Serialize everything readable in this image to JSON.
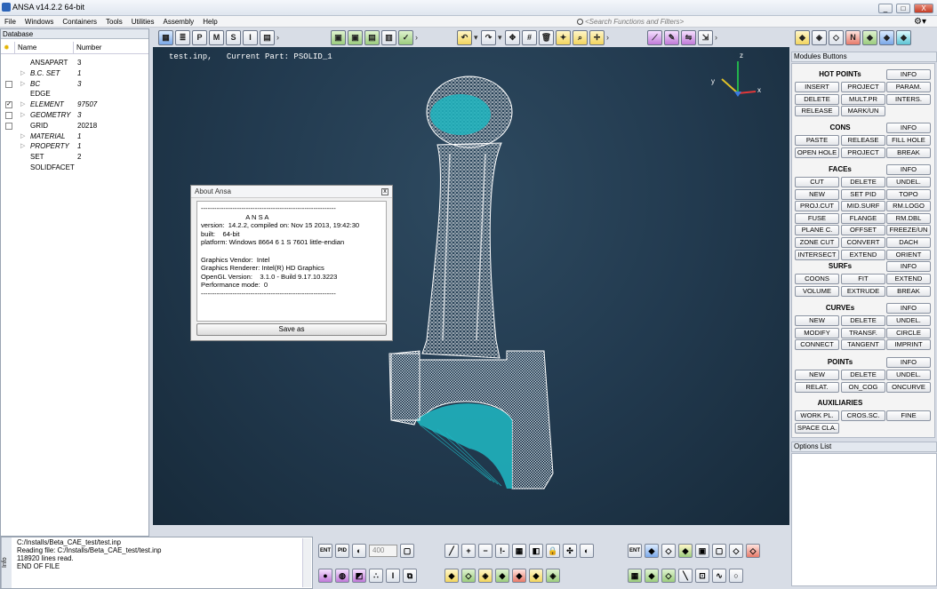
{
  "window": {
    "title": "ANSA v14.2.2 64-bit",
    "controls": [
      "_",
      "□",
      "X"
    ]
  },
  "menu": [
    "File",
    "Windows",
    "Containers",
    "Tools",
    "Utilities",
    "Assembly",
    "Help"
  ],
  "search": {
    "placeholder": "<Search Functions and Filters>"
  },
  "database": {
    "title": "Database",
    "columns": [
      "Name",
      "Number"
    ],
    "rows": [
      {
        "name": "ANSAPART",
        "number": "3",
        "italic": false,
        "checkbox": false,
        "expander": false
      },
      {
        "name": "B.C. SET",
        "number": "1",
        "italic": true,
        "checkbox": false,
        "expander": true
      },
      {
        "name": "BC",
        "number": "3",
        "italic": true,
        "checkbox": true,
        "expander": true,
        "checked": false
      },
      {
        "name": "EDGE",
        "number": "",
        "italic": false,
        "checkbox": false,
        "expander": false
      },
      {
        "name": "ELEMENT",
        "number": "97507",
        "italic": true,
        "checkbox": true,
        "expander": true,
        "checked": true
      },
      {
        "name": "GEOMETRY",
        "number": "3",
        "italic": true,
        "checkbox": true,
        "expander": true,
        "checked": false
      },
      {
        "name": "GRID",
        "number": "20218",
        "italic": false,
        "checkbox": true,
        "expander": false,
        "checked": false
      },
      {
        "name": "MATERIAL",
        "number": "1",
        "italic": true,
        "checkbox": false,
        "expander": true
      },
      {
        "name": "PROPERTY",
        "number": "1",
        "italic": true,
        "checkbox": false,
        "expander": true
      },
      {
        "name": "SET",
        "number": "2",
        "italic": false,
        "checkbox": false,
        "expander": false
      },
      {
        "name": "SOLIDFACET",
        "number": "",
        "italic": false,
        "checkbox": false,
        "expander": false
      }
    ]
  },
  "viewport": {
    "file": "test.inp,",
    "current_part": "Current Part: PSOLID_1",
    "axis": {
      "x": "x",
      "y": "y",
      "z": "z"
    }
  },
  "about": {
    "title": "About Ansa",
    "lines": [
      "------------------------------------------------------------",
      "                        A N S A",
      "version:  14.2.2, compiled on: Nov 15 2013, 19:42:30",
      "built:    64-bit",
      "platform: Windows 8664 6 1 S 7601 little-endian",
      "",
      "Graphics Vendor:  Intel",
      "Graphics Renderer: Intel(R) HD Graphics",
      "OpenGL Version:    3.1.0 - Build 9.17.10.3223",
      "Performance mode:  0",
      "------------------------------------------------------------"
    ],
    "save_label": "Save as"
  },
  "modules": {
    "title": "Modules Buttons",
    "sections": [
      {
        "title": "HOT POINTs",
        "info": "INFO",
        "buttons": [
          "INSERT",
          "PROJECT",
          "PARAM.",
          "DELETE",
          "MULT.PR",
          "INTERS.",
          "RELEASE",
          "MARK/UN"
        ]
      },
      {
        "title": "CONS",
        "info": "INFO",
        "buttons": [
          "PASTE",
          "RELEASE",
          "FILL HOLE",
          "OPEN HOLE",
          "PROJECT",
          "BREAK"
        ]
      },
      {
        "title": "FACEs",
        "info": "INFO",
        "buttons": [
          "CUT",
          "DELETE",
          "UNDEL.",
          "NEW",
          "SET PID",
          "TOPO",
          "PROJ.CUT",
          "MID.SURF",
          "RM.LOGO",
          "FUSE",
          "FLANGE",
          "RM.DBL",
          "PLANE C.",
          "OFFSET",
          "FREEZE/UN",
          "ZONE CUT",
          "CONVERT",
          "DACH",
          "INTERSECT",
          "EXTEND",
          "ORIENT"
        ]
      },
      {
        "title": "SURFs",
        "info": "INFO",
        "buttons": [
          "COONS",
          "FIT",
          "EXTEND",
          "VOLUME",
          "EXTRUDE",
          "BREAK"
        ]
      },
      {
        "title": "CURVEs",
        "info": "INFO",
        "buttons": [
          "NEW",
          "DELETE",
          "UNDEL.",
          "MODIFY",
          "TRANSF.",
          "CIRCLE",
          "CONNECT",
          "TANGENT",
          "IMPRINT"
        ]
      },
      {
        "title": "POINTs",
        "info": "INFO",
        "buttons": [
          "NEW",
          "DELETE",
          "UNDEL.",
          "RELAT.",
          "ON_COG",
          "ONCURVE"
        ]
      },
      {
        "title": "AUXILIARIES",
        "info": "",
        "buttons": [
          "WORK PL.",
          "CROS.SC.",
          "FINE",
          "SPACE CLA."
        ]
      }
    ]
  },
  "options": {
    "title": "Options List"
  },
  "console": {
    "side": "Info",
    "lines": [
      "C:/Installs/Beta_CAE_test/test.inp",
      "Reading file: C:/Installs/Beta_CAE_test/test.inp",
      "118920 lines read.",
      "END OF FILE"
    ]
  },
  "bottom_toolbar": {
    "ent_label": "ENT",
    "pid_label": "PID",
    "size_value": "400"
  },
  "colors": {
    "viewport_bg": "#223a4f",
    "mesh": "#ffffff",
    "selection": "#1fb5c0"
  }
}
